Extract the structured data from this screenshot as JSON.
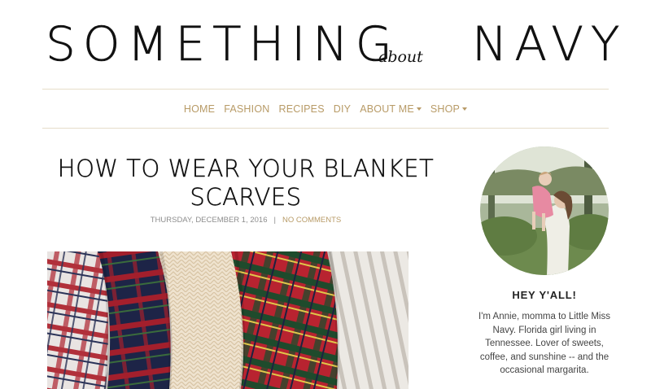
{
  "header": {
    "logo_left": "SOMETHING",
    "logo_script": "about",
    "logo_right": "NAVY"
  },
  "nav": {
    "items": [
      {
        "label": "HOME",
        "dropdown": false
      },
      {
        "label": "FASHION",
        "dropdown": false
      },
      {
        "label": "RECIPES",
        "dropdown": false
      },
      {
        "label": "DIY",
        "dropdown": false
      },
      {
        "label": "ABOUT ME",
        "dropdown": true
      },
      {
        "label": "SHOP",
        "dropdown": true
      }
    ]
  },
  "post": {
    "title": "HOW TO WEAR YOUR BLANKET SCARVES",
    "date": "THURSDAY, DECEMBER 1, 2016",
    "separator": "|",
    "comments": "NO COMMENTS"
  },
  "sidebar": {
    "heading": "HEY Y'ALL!",
    "bio": "I'm Annie, momma to Little Miss Navy. Florida girl living in Tennessee. Lover of sweets, coffee, and sunshine -- and the occasional margarita."
  },
  "colors": {
    "accent": "#b89b67",
    "divider": "#e6ddc9",
    "text": "#222222"
  }
}
